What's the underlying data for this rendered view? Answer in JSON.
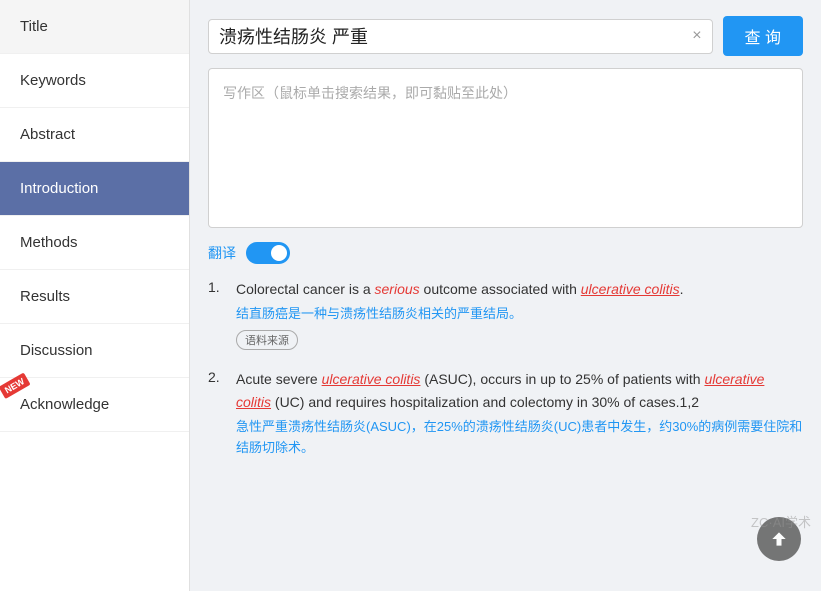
{
  "sidebar": {
    "items": [
      {
        "id": "title",
        "label": "Title",
        "active": false,
        "new": false
      },
      {
        "id": "keywords",
        "label": "Keywords",
        "active": false,
        "new": false
      },
      {
        "id": "abstract",
        "label": "Abstract",
        "active": false,
        "new": false
      },
      {
        "id": "introduction",
        "label": "Introduction",
        "active": true,
        "new": false
      },
      {
        "id": "methods",
        "label": "Methods",
        "active": false,
        "new": false
      },
      {
        "id": "results",
        "label": "Results",
        "active": false,
        "new": false
      },
      {
        "id": "discussion",
        "label": "Discussion",
        "active": false,
        "new": false
      },
      {
        "id": "acknowledge",
        "label": "Acknowledge",
        "active": false,
        "new": true
      }
    ]
  },
  "search": {
    "value": "溃疡性结肠炎 严重",
    "placeholder": "写作区（鼠标单击搜索结果，即可黏贴至此处）",
    "clear_label": "×",
    "button_label": "查 询"
  },
  "translate": {
    "label": "翻译",
    "new_badge": "NEW"
  },
  "results": [
    {
      "num": "1.",
      "en_parts": [
        {
          "text": "Colorectal cancer is a ",
          "style": "normal"
        },
        {
          "text": "serious",
          "style": "italic-red"
        },
        {
          "text": " outcome associated with ",
          "style": "normal"
        },
        {
          "text": "ulcerative colitis",
          "style": "italic-red-underline"
        },
        {
          "text": ".",
          "style": "normal"
        }
      ],
      "cn": "结直肠癌是一种与溃疡性结肠炎相关的严重结局。",
      "source": "语料来源"
    },
    {
      "num": "2.",
      "en_parts": [
        {
          "text": "Acute severe ",
          "style": "normal"
        },
        {
          "text": "ulcerative colitis",
          "style": "italic-red-underline"
        },
        {
          "text": " (ASUC), occurs in up to 25% of patients with ",
          "style": "normal"
        },
        {
          "text": "ulcerative colitis",
          "style": "italic-red-underline"
        },
        {
          "text": " (UC) and requires hospitalization and colectomy in 30% of cases.1,2",
          "style": "normal"
        }
      ],
      "cn": "急性严重溃疡性结肠炎(ASUC)，在25%的溃疡性结肠炎(UC)患者中发生，约30%的病例需要住院和结肠切除术。",
      "source": null
    }
  ],
  "scroll_top": "↑",
  "watermark": "ZC·AI学术"
}
